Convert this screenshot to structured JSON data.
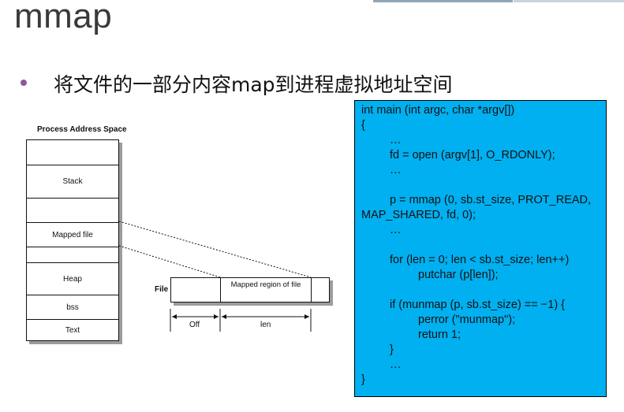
{
  "title": "mmap",
  "bullet": "将文件的一部分内容map到进程虚拟地址空间",
  "diagram": {
    "process_label": "Process Address Space",
    "segments": [
      "",
      "Stack",
      "",
      "Mapped file",
      "",
      "Heap",
      "bss",
      "Text"
    ],
    "file_label": "File",
    "mapped_region": "Mapped region of file",
    "off_label": "Off",
    "len_label": "len"
  },
  "code": {
    "lines": [
      "int main (int argc, char *argv[])",
      "{",
      "\t…",
      "\tfd = open (argv[1], O_RDONLY);",
      "\t…",
      "",
      "\tp = mmap (0, sb.st_size, PROT_READ,",
      "MAP_SHARED, fd, 0);",
      "\t…",
      "",
      "\tfor (len = 0; len < sb.st_size; len++)",
      "\t\tputchar (p[len]);",
      "",
      "\tif (munmap (p, sb.st_size) == −1) {",
      "\t\tperror (\"munmap\");",
      "\t\treturn 1;",
      "\t}",
      "\t…",
      "}"
    ]
  },
  "colors": {
    "code_bg": "#00b0f0",
    "bullet": "#8a58a0",
    "title": "#3a3a3a"
  }
}
